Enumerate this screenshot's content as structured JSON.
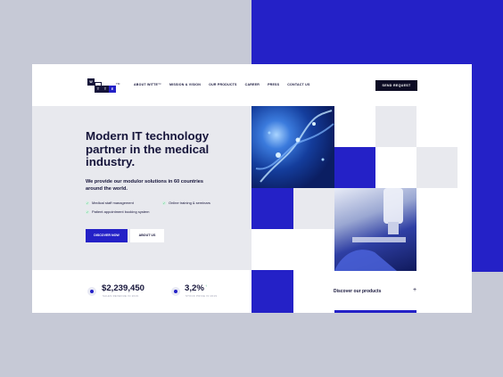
{
  "brand": {
    "logo_letters": [
      "W",
      "I",
      "T",
      "T",
      "E"
    ],
    "tm": "TM"
  },
  "nav": {
    "items": [
      "ABOUT WITTE™",
      "MISSION & VISION",
      "OUR PRODUCTS",
      "CAREER",
      "PRESS",
      "CONTACT US"
    ],
    "send_request": "SEND REQUEST"
  },
  "hero": {
    "title": "Modern IT technology partner in the medical industry.",
    "subtitle": "We provide our modulor solutions in 60 countries around the world.",
    "features": [
      "Medical staff management",
      "Online training & seminars",
      "Patient appointment booking system"
    ],
    "cta_primary": "DISCOVER NOW",
    "cta_secondary": "ABOUT US"
  },
  "stats": [
    {
      "value": "$2,239,450",
      "label": "SALES REVENUE IN 2019"
    },
    {
      "value": "3,2%",
      "label": "STOCK PRICE IN 2019",
      "trend": "↑"
    }
  ],
  "products": {
    "label": "Discover our products",
    "icon": "plus-icon"
  },
  "colors": {
    "accent": "#2421c7",
    "dark": "#15143a",
    "background": "#c6c9d6",
    "panel": "#e8e9ee"
  }
}
